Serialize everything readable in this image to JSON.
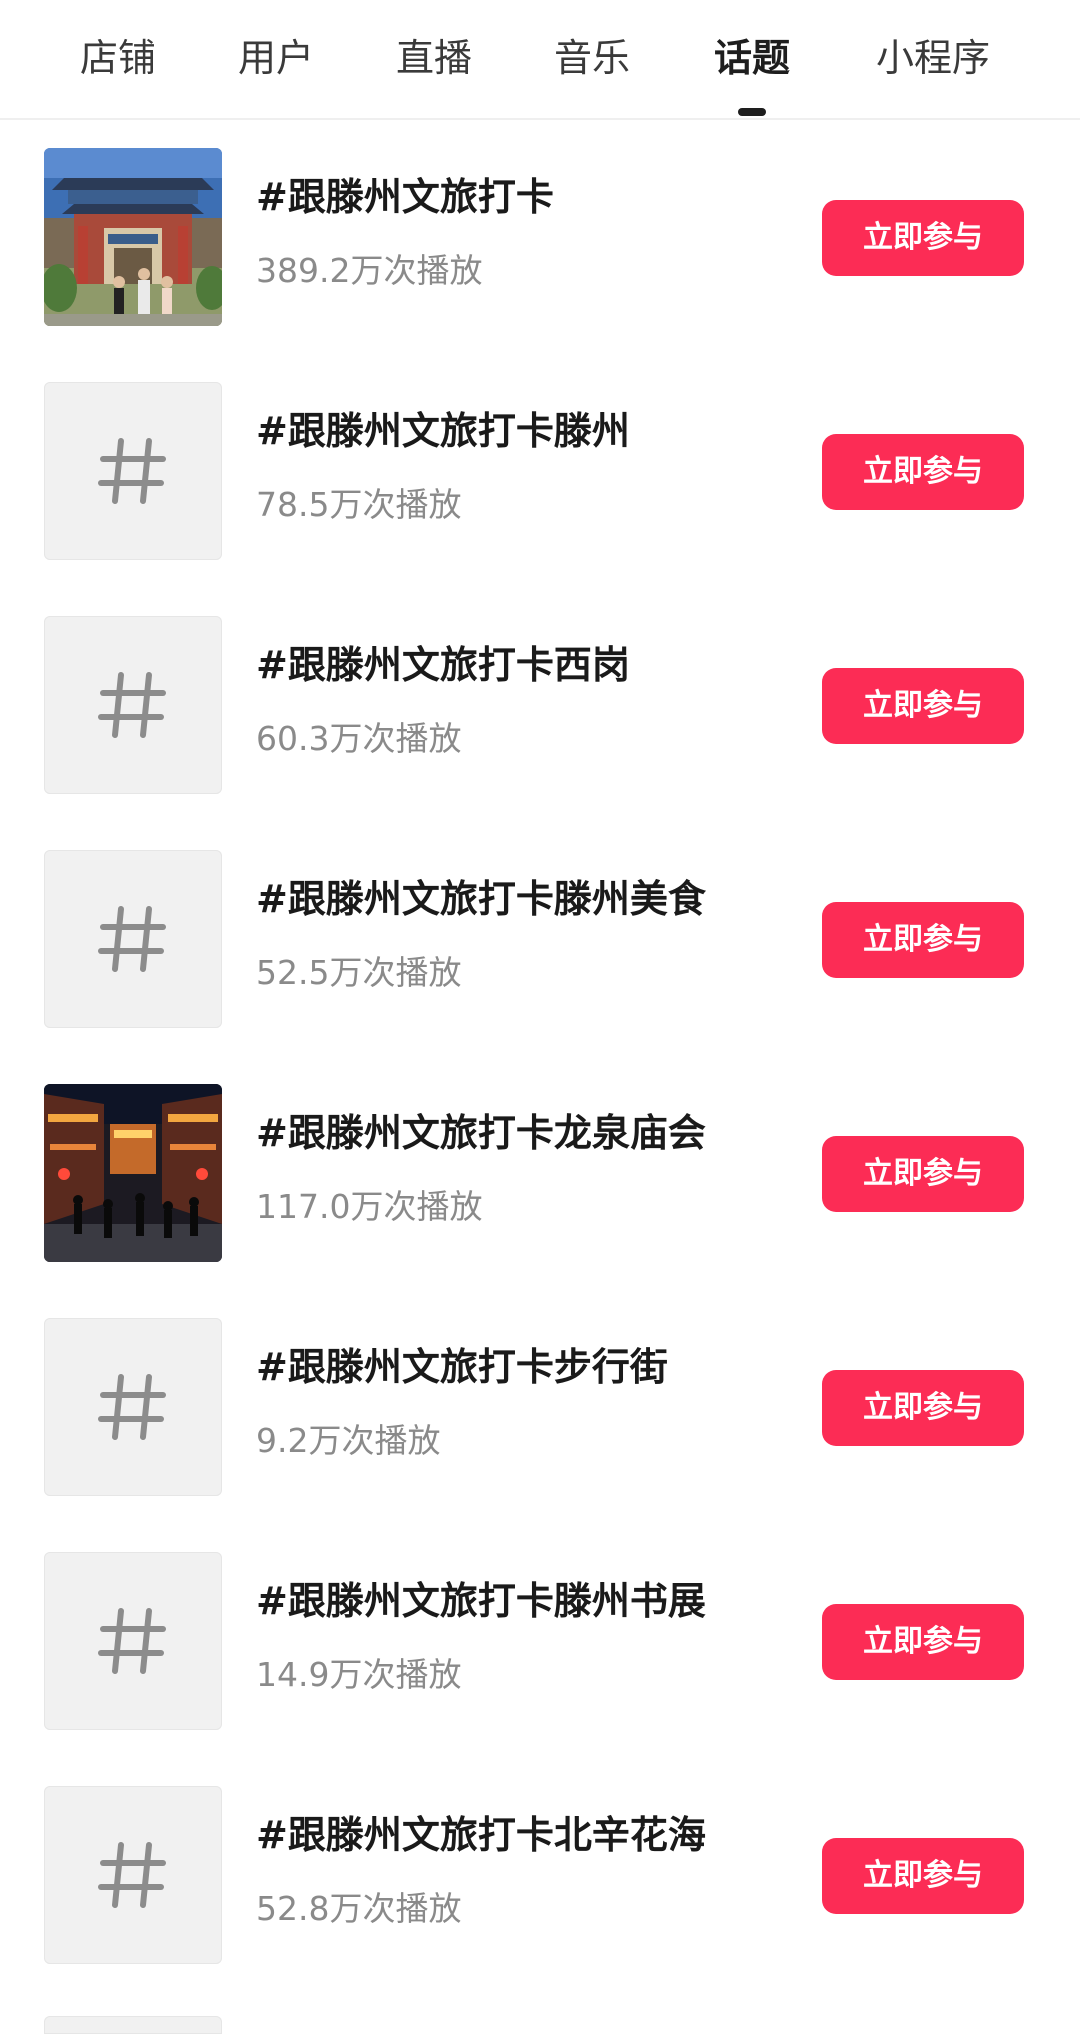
{
  "tabs": [
    {
      "label": "店铺",
      "active": false
    },
    {
      "label": "用户",
      "active": false
    },
    {
      "label": "直播",
      "active": false
    },
    {
      "label": "音乐",
      "active": false
    },
    {
      "label": "话题",
      "active": true
    },
    {
      "label": "小程序",
      "active": false
    }
  ],
  "topics": [
    {
      "title": "#跟滕州文旅打卡",
      "plays": "389.2万次播放",
      "thumb": "photo-temple-gate",
      "button": "立即参与"
    },
    {
      "title": "#跟滕州文旅打卡滕州",
      "plays": "78.5万次播放",
      "thumb": "hashtag-icon",
      "button": "立即参与"
    },
    {
      "title": "#跟滕州文旅打卡西岗",
      "plays": "60.3万次播放",
      "thumb": "hashtag-icon",
      "button": "立即参与"
    },
    {
      "title": "#跟滕州文旅打卡滕州美食",
      "plays": "52.5万次播放",
      "thumb": "hashtag-icon",
      "button": "立即参与"
    },
    {
      "title": "#跟滕州文旅打卡龙泉庙会",
      "plays": "117.0万次播放",
      "thumb": "photo-night-street",
      "button": "立即参与"
    },
    {
      "title": "#跟滕州文旅打卡步行街",
      "plays": "9.2万次播放",
      "thumb": "hashtag-icon",
      "button": "立即参与"
    },
    {
      "title": "#跟滕州文旅打卡滕州书展",
      "plays": "14.9万次播放",
      "thumb": "hashtag-icon",
      "button": "立即参与"
    },
    {
      "title": "#跟滕州文旅打卡北辛花海",
      "plays": "52.8万次播放",
      "thumb": "hashtag-icon",
      "button": "立即参与"
    }
  ],
  "colors": {
    "accent": "#fc2c55",
    "text_primary": "#1a1a1a",
    "text_secondary": "#8a8a8a",
    "placeholder_bg": "#f1f1f1"
  }
}
